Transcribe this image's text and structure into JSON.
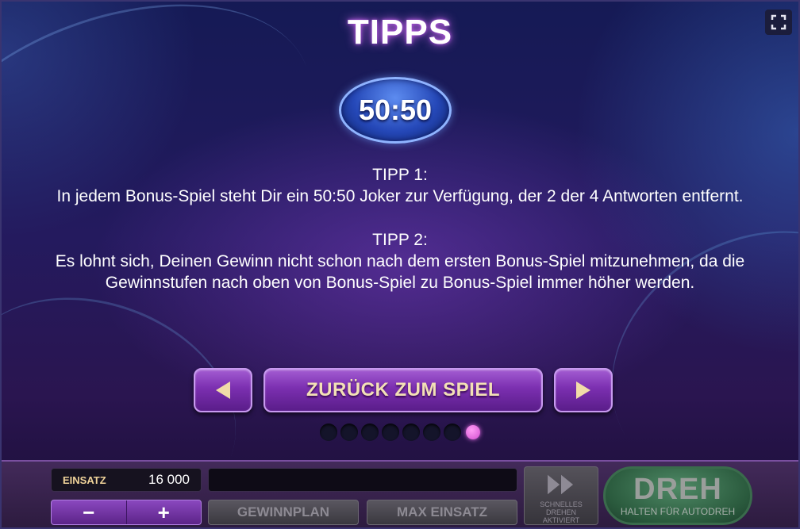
{
  "header": {
    "title": "TIPPS"
  },
  "logo": {
    "text": "50:50"
  },
  "tips": [
    {
      "heading": "TIPP 1:",
      "text": "In jedem Bonus-Spiel steht Dir ein 50:50 Joker zur Verfügung, der 2 der 4 Antworten entfernt."
    },
    {
      "heading": "TIPP 2:",
      "text": "Es lohnt sich, Deinen Gewinn nicht schon nach dem ersten Bonus-Spiel mitzunehmen, da die Gewinnstufen nach oben von Bonus-Spiel zu Bonus-Spiel immer höher werden."
    }
  ],
  "navigation": {
    "back_label": "ZURÜCK ZUM SPIEL",
    "prev_icon": "arrow-left-icon",
    "next_icon": "arrow-right-icon",
    "page_count": 8,
    "active_page": 8
  },
  "controls": {
    "bet_label": "EINSATZ",
    "bet_value": "16 000",
    "minus": "−",
    "plus": "+",
    "paytable_label": "GEWINNPLAN",
    "max_bet_label": "MAX EINSATZ",
    "fast_spin_label_1": "SCHNELLES DREHEN",
    "fast_spin_label_2": "AKTIVIERT",
    "spin_label": "DREH",
    "spin_sub_label": "HALTEN FÜR AUTODREH"
  },
  "colors": {
    "accent_purple": "#7b2fb0",
    "button_text_gold": "#f3e0b6",
    "active_dot": "#d24fd0",
    "spin_green": "#2a5a3d"
  }
}
